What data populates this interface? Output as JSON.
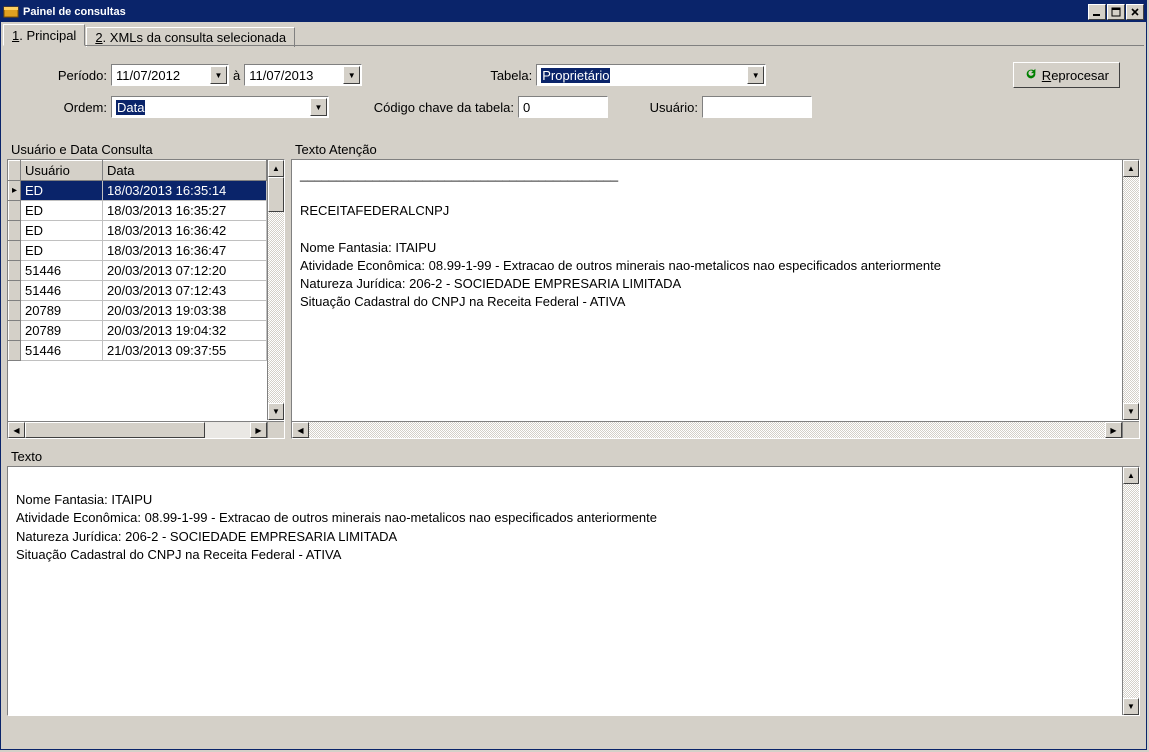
{
  "window": {
    "title": "Painel de consultas"
  },
  "tabs": [
    {
      "label_num": "1",
      "label_text": ". Principal"
    },
    {
      "label_num": "2",
      "label_text": ". XMLs da consulta selecionada"
    }
  ],
  "filters": {
    "periodo_label": "Período:",
    "date_from": "11/07/2012",
    "a_label": "à",
    "date_to": "11/07/2013",
    "tabela_label": "Tabela:",
    "tabela_value": "Proprietário",
    "ordem_label": "Ordem:",
    "ordem_value": "Data",
    "codigo_label": "Código chave da tabela:",
    "codigo_value": "0",
    "usuario_label": "Usuário:",
    "usuario_value": "",
    "reprocessar_label": "Reprocesar",
    "reprocessar_key": "R"
  },
  "left_panel": {
    "title": "Usuário e Data Consulta",
    "columns": {
      "usuario": "Usuário",
      "data": "Data"
    },
    "rows": [
      {
        "usuario": "ED",
        "data": "18/03/2013 16:35:14",
        "selected": true
      },
      {
        "usuario": "ED",
        "data": "18/03/2013 16:35:27"
      },
      {
        "usuario": "ED",
        "data": "18/03/2013 16:36:42"
      },
      {
        "usuario": "ED",
        "data": "18/03/2013 16:36:47"
      },
      {
        "usuario": "51446",
        "data": "20/03/2013 07:12:20"
      },
      {
        "usuario": "51446",
        "data": "20/03/2013 07:12:43"
      },
      {
        "usuario": "20789",
        "data": "20/03/2013 19:03:38"
      },
      {
        "usuario": "20789",
        "data": "20/03/2013 19:04:32"
      },
      {
        "usuario": "51446",
        "data": "21/03/2013 09:37:55"
      }
    ]
  },
  "right_panel": {
    "title": "Texto Atenção",
    "text": "____________________________________________\n\nRECEITAFEDERALCNPJ\n\nNome Fantasia: ITAIPU\nAtividade Econômica: 08.99-1-99 - Extracao de outros minerais nao-metalicos nao especificados anteriormente\nNatureza Jurídica: 206-2 - SOCIEDADE EMPRESARIA LIMITADA\nSituação Cadastral do CNPJ na Receita Federal - ATIVA"
  },
  "bottom_panel": {
    "title": "Texto",
    "text": "\nNome Fantasia: ITAIPU\nAtividade Econômica: 08.99-1-99 - Extracao de outros minerais nao-metalicos nao especificados anteriormente\nNatureza Jurídica: 206-2 - SOCIEDADE EMPRESARIA LIMITADA\nSituação Cadastral do CNPJ na Receita Federal - ATIVA"
  }
}
